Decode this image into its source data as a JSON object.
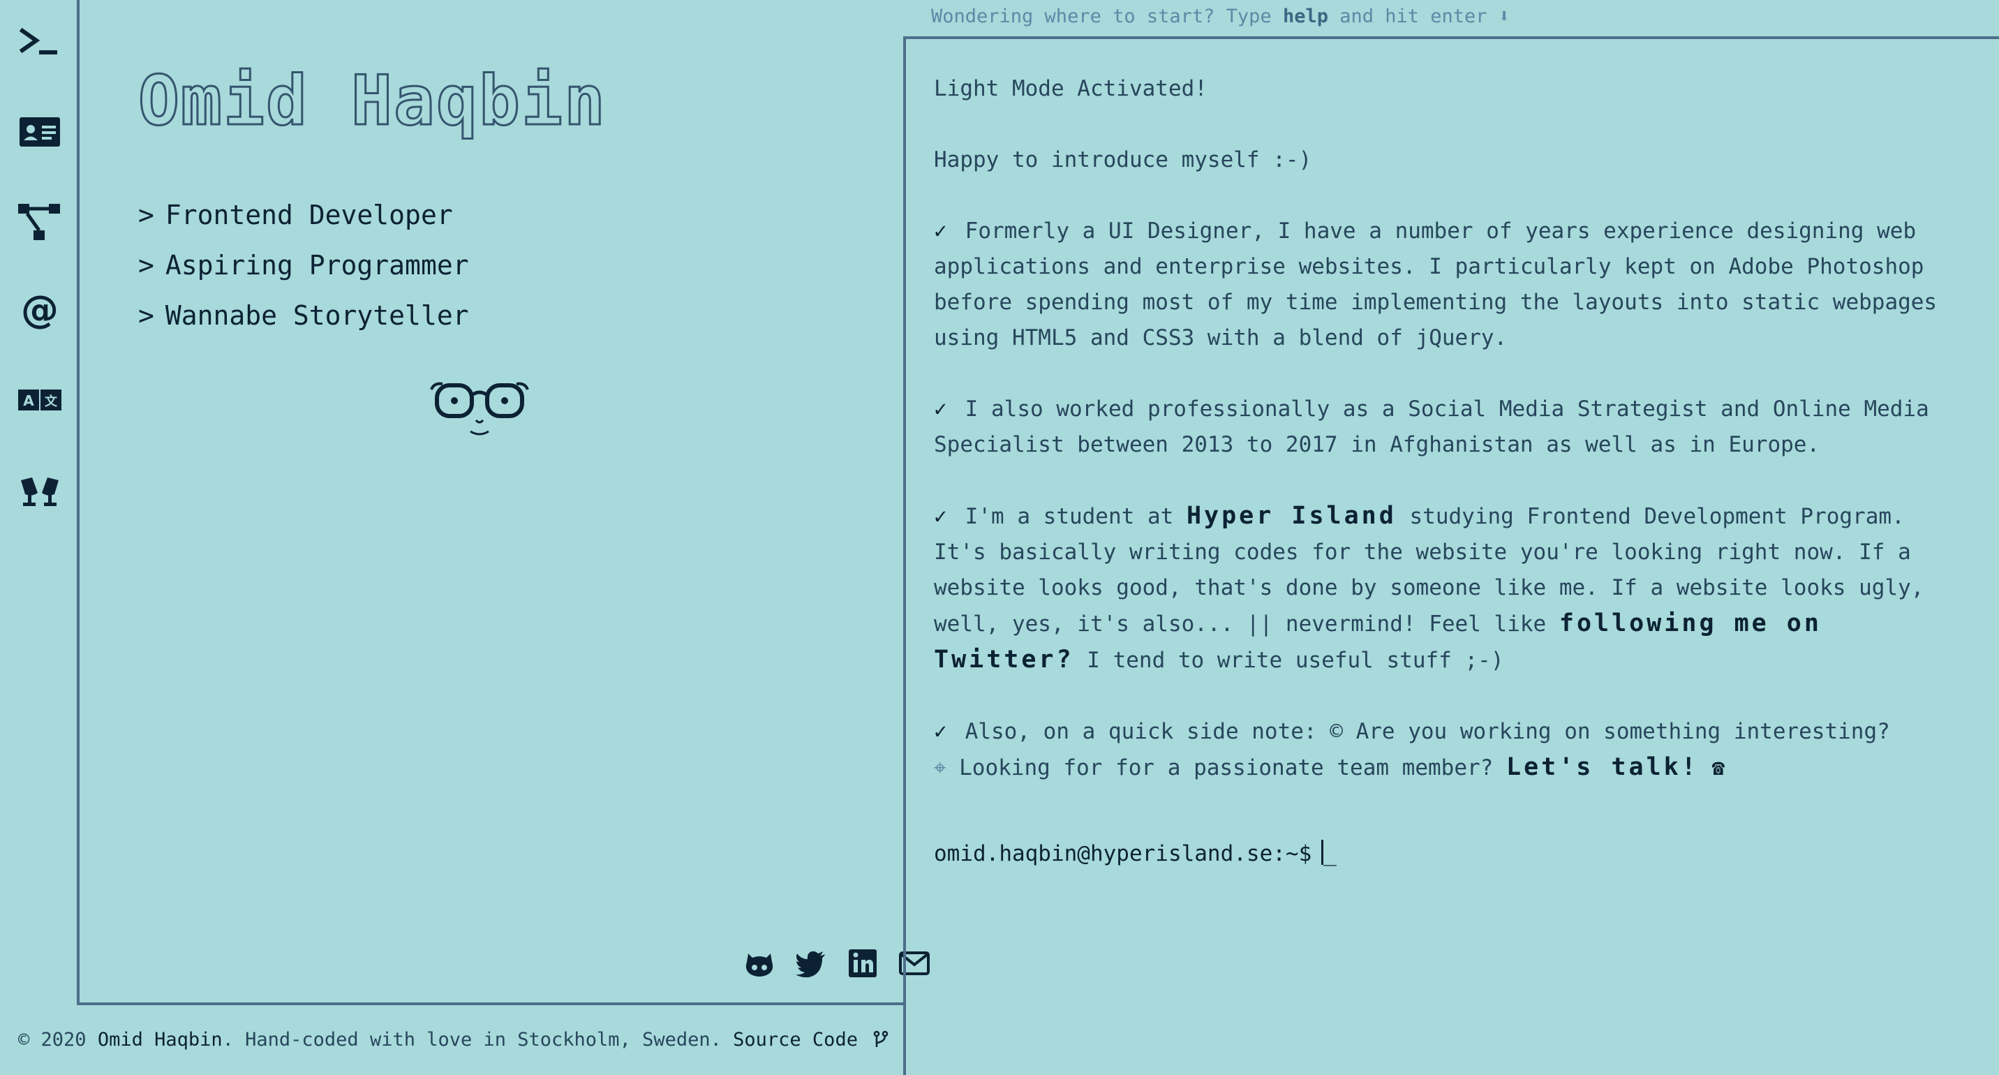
{
  "header_hint": {
    "prefix": "Wondering where to start? Type",
    "keyword": "help",
    "suffix": "and hit enter",
    "arrow": "⬇"
  },
  "sidebar": {
    "items": [
      {
        "icon": "terminal-icon"
      },
      {
        "icon": "id-card-icon"
      },
      {
        "icon": "sitemap-icon"
      },
      {
        "icon": "at-sign-icon"
      },
      {
        "icon": "translate-icon"
      },
      {
        "icon": "glasses-icon"
      }
    ]
  },
  "profile": {
    "name": "Omid Haqbin",
    "roles": [
      "Frontend Developer",
      "Aspiring Programmer",
      "Wannabe Storyteller"
    ],
    "role_prefix": ">"
  },
  "social": [
    {
      "icon": "github-icon"
    },
    {
      "icon": "twitter-icon"
    },
    {
      "icon": "linkedin-icon"
    },
    {
      "icon": "email-icon"
    }
  ],
  "footer": {
    "copyright": "© 2020",
    "author": "Omid Haqbin",
    "text": ". Hand-coded with love in Stockholm, Sweden.",
    "source_label": "Source Code",
    "source_icon": "code-branch-icon"
  },
  "terminal": {
    "line1": "Light Mode Activated!",
    "line2": "Happy to introduce myself :-)",
    "check": "✓",
    "para1": "Formerly a UI Designer, I have a number of years experience designing web applications and enterprise websites. I particularly kept on Adobe Photoshop before spending most of my time implementing the layouts into static webpages using HTML5 and CSS3 with a blend of jQuery.",
    "para2": "I also worked professionally as a Social Media Strategist and Online Media Specialist between 2013 to 2017 in Afghanistan as well as in Europe.",
    "para3_a": "I'm a student at",
    "para3_link": "Hyper Island",
    "para3_b": "studying Frontend Development Program. It's basically writing codes for the website you're looking right now. If a website looks good, that's done by someone like me. If a website looks ugly, well, yes, it's also... || nevermind! Feel like",
    "para3_link2": "following me on Twitter?",
    "para3_c": "I tend to write useful stuff ;-)",
    "para4_a": "Also, on a quick side note: © Are you working on something interesting?",
    "para4_b": "Looking for for a passionate team member?",
    "para4_link": "Let's talk!",
    "phone_glyph": "☎",
    "crosshair_glyph": "⌖",
    "prompt": "omid.haqbin@hyperisland.se:~$",
    "cursor_glyph": "_"
  },
  "colors": {
    "background": "#a8d9db",
    "ink": "#0c2234",
    "border": "#4d6f8a",
    "muted": "#5c8aa6"
  }
}
